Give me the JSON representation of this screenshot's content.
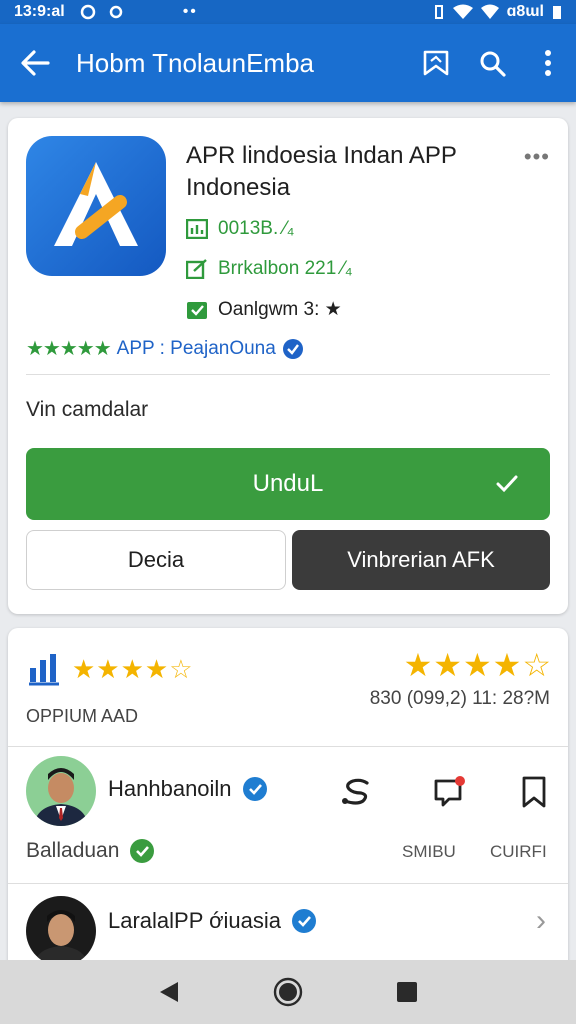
{
  "status_bar": {
    "time": "13:9:al",
    "dots": "••",
    "right_text": "ɑ8ɯl"
  },
  "app_bar": {
    "title": "Hobm TnolaunEmba"
  },
  "app": {
    "title": "APR Ɩindoesia Indan APP Indonesia",
    "meta_size": "0013B. ⁄₄",
    "meta_update": "Brrkalbon 221 ⁄₄",
    "meta_rating": "Oanlgwm 3: ★",
    "rating_stars": "★★★★★",
    "rating_label": "APP : PeajanOuna",
    "subtitle": "Vin camdalar",
    "install_label": "UnduL",
    "secondary_label": "Decia",
    "dark_label": "Vinbrerian AFK"
  },
  "reviews": {
    "left_stars_filled": "★★★★",
    "left_stars_empty": "☆",
    "left_label": "OPPIUM AAD",
    "right_stars_filled": "★★★★",
    "right_stars_empty": "☆",
    "right_text": "830 (099,2)  11: 28?M",
    "user1": {
      "name": "Hanhbanoiln",
      "sub": "Balladuan",
      "action1_label": "SMIBU",
      "action2_label": "CUIRFI"
    },
    "user2": {
      "name": "LaralalPP ớiuasia"
    }
  },
  "colors": {
    "primary": "#1a6fd1",
    "install_green": "#3a9c3f",
    "star_yellow": "#f4b400",
    "dark_button": "#3b3b3b"
  },
  "icons": {
    "back": "arrow-left-icon",
    "bookmark": "bookmark-icon",
    "search": "search-icon",
    "more": "more-vert-icon"
  }
}
